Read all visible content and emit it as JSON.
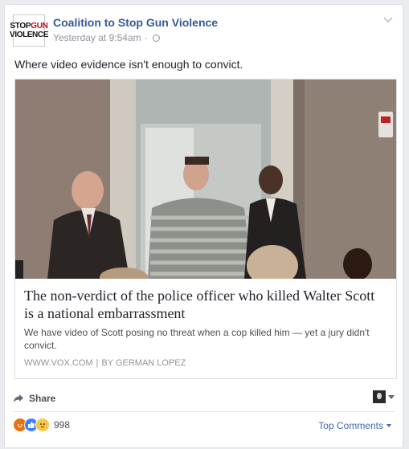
{
  "post": {
    "page_name": "Coalition to Stop Gun Violence",
    "timestamp": "Yesterday at 9:54am",
    "separator": "·",
    "privacy_icon": "globe-icon",
    "menu_icon": "chevron-down-icon",
    "message": "Where video evidence isn't enough to convict."
  },
  "avatar": {
    "stop": "STOP",
    "gun": "GUN",
    "violence": "VIOLENCE"
  },
  "link_card": {
    "title": "The non-verdict of the police officer who killed Walter Scott is a national embarrassment",
    "description": "We have video of Scott posing no threat when a cop killed him — yet a jury didn't convict.",
    "domain": "WWW.VOX.COM",
    "divider": "|",
    "byline": "BY GERMAN LOPEZ"
  },
  "actions": {
    "share_label": "Share"
  },
  "reactions": {
    "count": "998",
    "types": [
      "angry",
      "like",
      "sad"
    ],
    "top_comments_label": "Top Comments"
  },
  "colors": {
    "link_blue": "#365899",
    "meta_gray": "#90949c",
    "angry": "#e9710f",
    "like": "#4080ff",
    "sad": "#f7c54a"
  }
}
